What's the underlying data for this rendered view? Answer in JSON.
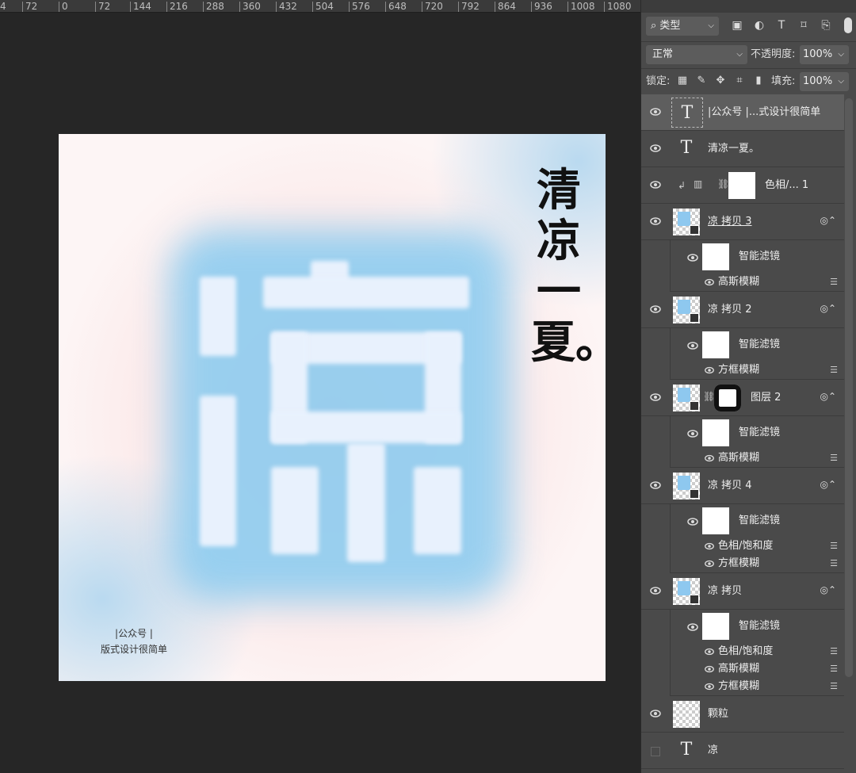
{
  "ruler": {
    "ticks": [
      "4",
      "72",
      "0",
      "72",
      "144",
      "216",
      "288",
      "360",
      "432",
      "504",
      "576",
      "648",
      "720",
      "792",
      "864",
      "936",
      "1008",
      "1080"
    ]
  },
  "artwork": {
    "vertical_title": "清凉一夏。",
    "credit_line1": "|公众号 |",
    "credit_line2": "版式设计很简单",
    "colors": {
      "blue_glow": "#8fcdf0",
      "glyph_fill": "#e8f1fd",
      "pink": "#f5cdcd"
    }
  },
  "panel": {
    "filter_kind": "类型",
    "filter_icons": [
      "image-filter-icon",
      "adjustment-filter-icon",
      "type-filter-icon",
      "shape-filter-icon",
      "smart-object-filter-icon"
    ],
    "blend_mode": "正常",
    "opacity_label": "不透明度:",
    "opacity_value": "100%",
    "lock_label": "锁定:",
    "lock_icons": [
      "lock-transparent-icon",
      "lock-paint-icon",
      "lock-position-icon",
      "lock-artboard-icon",
      "lock-all-icon"
    ],
    "fill_label": "填充:",
    "fill_value": "100%"
  },
  "layers": [
    {
      "name": "|公众号 |...式设计很简单",
      "kind": "text",
      "selected": true
    },
    {
      "name": "清凉一夏。",
      "kind": "text"
    },
    {
      "name": "色相/... 1",
      "kind": "adjustment"
    },
    {
      "name": "凉 拷贝 3",
      "kind": "smart",
      "filters_label": "智能滤镜",
      "filters": [
        "高斯模糊"
      ]
    },
    {
      "name": "凉 拷贝 2",
      "kind": "smart",
      "filters_label": "智能滤镜",
      "filters": [
        "方框模糊"
      ]
    },
    {
      "name": "图层 2",
      "kind": "smart-mask",
      "filters_label": "智能滤镜",
      "filters": [
        "高斯模糊"
      ]
    },
    {
      "name": "凉 拷贝 4",
      "kind": "smart",
      "filters_label": "智能滤镜",
      "filters": [
        "色相/饱和度",
        "方框模糊"
      ]
    },
    {
      "name": "凉 拷贝",
      "kind": "smart",
      "filters_label": "智能滤镜",
      "filters": [
        "色相/饱和度",
        "高斯模糊",
        "方框模糊"
      ]
    },
    {
      "name": "颗粒",
      "kind": "pixel"
    },
    {
      "name": "凉",
      "kind": "text",
      "hidden": true
    }
  ]
}
